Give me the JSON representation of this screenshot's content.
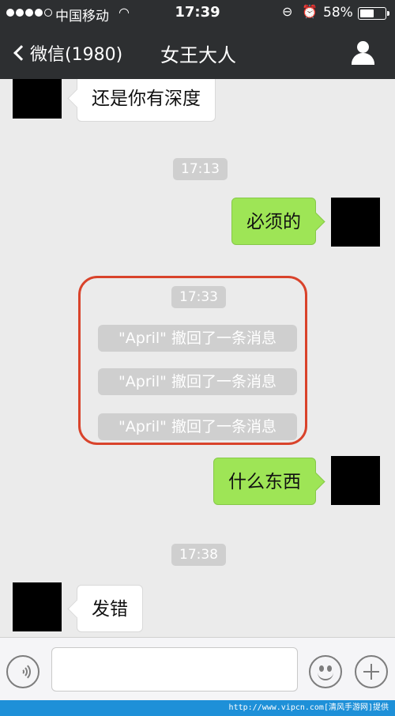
{
  "status_bar": {
    "carrier": "中国移动",
    "time": "17:39",
    "battery_percent": "58%",
    "battery_level": 0.58
  },
  "nav": {
    "back_label": "微信(1980)",
    "title": "女王大人"
  },
  "messages": [
    {
      "type": "incoming",
      "text": "还是你有深度"
    },
    {
      "type": "time",
      "text": "17:13"
    },
    {
      "type": "outgoing",
      "text": "必须的"
    },
    {
      "type": "time",
      "text": "17:33"
    },
    {
      "type": "recall",
      "text": "\"April\" 撤回了一条消息"
    },
    {
      "type": "recall",
      "text": "\"April\" 撤回了一条消息"
    },
    {
      "type": "recall",
      "text": "\"April\" 撤回了一条消息"
    },
    {
      "type": "outgoing",
      "text": "什么东西"
    },
    {
      "type": "time",
      "text": "17:38"
    },
    {
      "type": "incoming",
      "text": "发错"
    }
  ],
  "input": {
    "value": "",
    "placeholder": ""
  },
  "icons": [
    "voice-icon",
    "emoji-icon",
    "add-icon",
    "back-chevron-icon",
    "contact-icon",
    "wifi-icon",
    "lock-rotation-icon",
    "alarm-icon",
    "battery-icon"
  ],
  "colors": {
    "outgoing_bubble": "#9ee556",
    "highlight_border": "#d9432b",
    "nav_bg": "#2d2f31"
  },
  "watermark": "http://www.vipcn.com[清风手游网]提供"
}
